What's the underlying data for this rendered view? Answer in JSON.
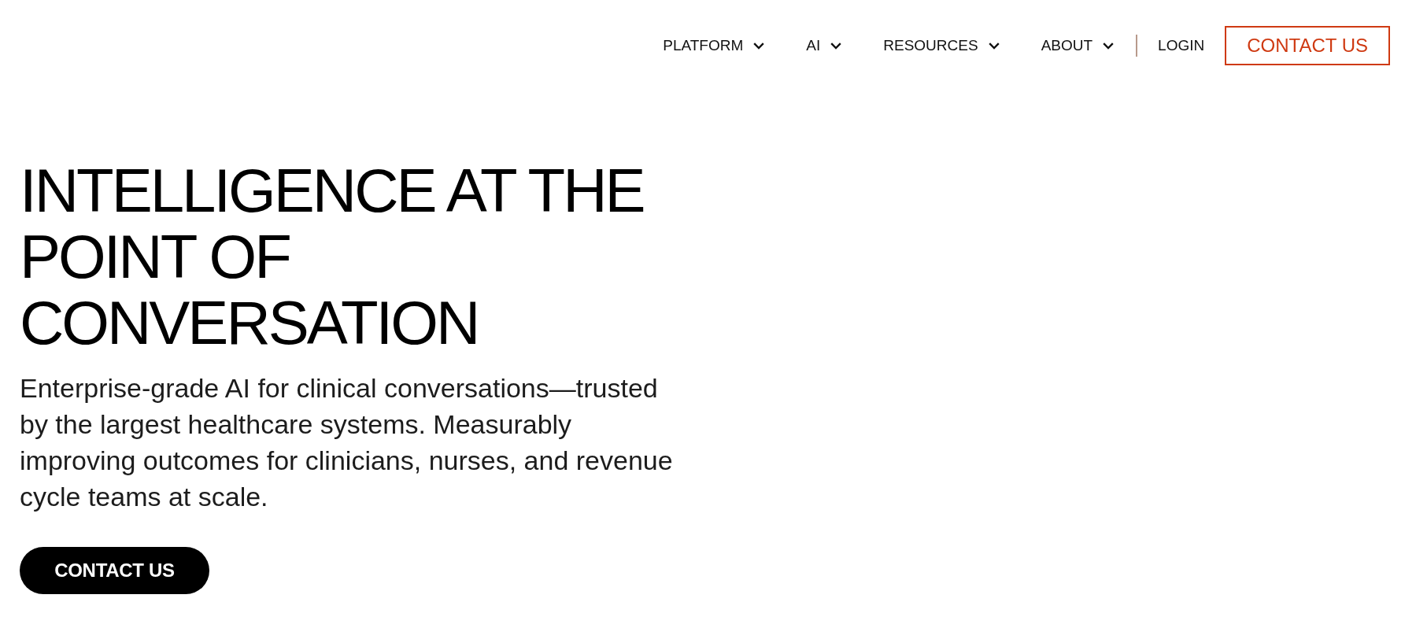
{
  "nav": {
    "items": [
      {
        "label": "PLATFORM",
        "kind": "dropdown"
      },
      {
        "label": "AI",
        "kind": "dropdown"
      },
      {
        "label": "RESOURCES",
        "kind": "dropdown"
      },
      {
        "label": "ABOUT",
        "kind": "dropdown"
      },
      {
        "label": "LOGIN",
        "kind": "link"
      }
    ],
    "cta": "CONTACT US"
  },
  "hero": {
    "heading": "INTELLIGENCE AT THE POINT OF CONVERSATION",
    "text": "Enterprise-grade AI for clinical conversations—trusted by the largest healthcare systems. Measurably improving outcomes for clinicians, nurses, and revenue cycle teams at scale.",
    "button": "CONTACT US"
  }
}
